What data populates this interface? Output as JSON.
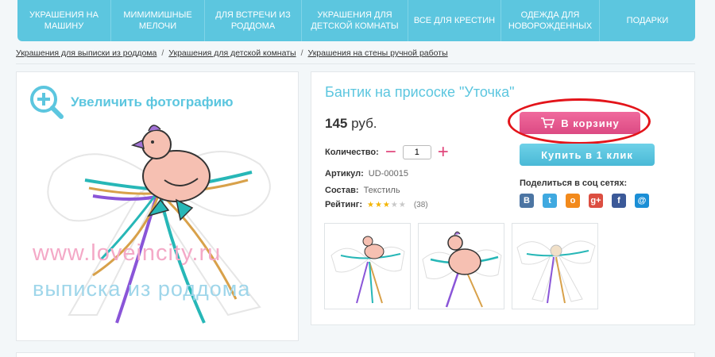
{
  "nav": {
    "items": [
      {
        "label": "Украшения на машину"
      },
      {
        "label": "Мимимишные мелочи"
      },
      {
        "label": "Для встречи из роддома"
      },
      {
        "label": "Украшения для детской комнаты"
      },
      {
        "label": "Все для крестин"
      },
      {
        "label": "Одежда для новорожденных"
      },
      {
        "label": "Подарки"
      }
    ]
  },
  "breadcrumb": {
    "items": [
      {
        "label": "Украшения для выписки из роддома"
      },
      {
        "label": "Украшения для детской комнаты"
      },
      {
        "label": "Украшения на стены ручной работы"
      }
    ],
    "separator": "/"
  },
  "gallery": {
    "zoom_label": "Увеличить фотографию",
    "watermark_site": "www.loveincity.ru",
    "watermark_caption": "выписка из роддома"
  },
  "product": {
    "title": "Бантик на присоске \"Уточка\"",
    "price": "145",
    "currency": "руб.",
    "quantity_label": "Количество:",
    "quantity_value": "1",
    "minus": "−",
    "plus": "+",
    "sku_label": "Артикул:",
    "sku_value": "UD-00015",
    "material_label": "Состав:",
    "material_value": "Текстиль",
    "rating_label": "Рейтинг:",
    "rating_value": 3,
    "rating_max": 5,
    "rating_count": "(38)"
  },
  "actions": {
    "cart_label": "В корзину",
    "one_click_label": "Купить в 1 клик",
    "share_label": "Поделиться в соц сетях:",
    "share": [
      {
        "icon": "vk-icon",
        "glyph": "В",
        "color": "#4c75a3"
      },
      {
        "icon": "twitter-icon",
        "glyph": "t",
        "color": "#3fa9e0"
      },
      {
        "icon": "odnoklassniki-icon",
        "glyph": "о",
        "color": "#f28a1c"
      },
      {
        "icon": "google-plus-icon",
        "glyph": "g+",
        "color": "#dc4e41"
      },
      {
        "icon": "facebook-icon",
        "glyph": "f",
        "color": "#3b5998"
      },
      {
        "icon": "mail-ru-icon",
        "glyph": "@",
        "color": "#1b8fd6"
      }
    ]
  },
  "colors": {
    "accent": "#5cc6df",
    "cart": "#e0457b",
    "highlight": "#e3141a"
  }
}
